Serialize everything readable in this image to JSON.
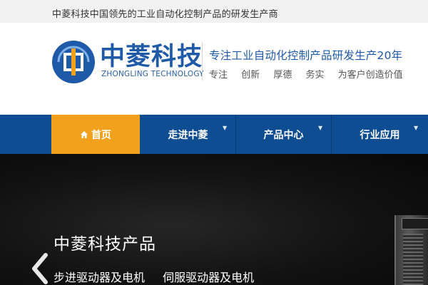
{
  "topbar": {
    "text": "中菱科技中国领先的工业自动化控制产品的研发生产商"
  },
  "header": {
    "logo_name": "中菱科技",
    "logo_en": "ZHONGLING TECHNOLOGY",
    "slogan": "专注工业自动化控制产品研发生产20年",
    "values": [
      "专注",
      "创新",
      "厚德",
      "务实",
      "为客户创造价值"
    ]
  },
  "nav": {
    "items": [
      {
        "label": "首页",
        "icon": "home-icon",
        "active": true
      },
      {
        "label": "走进中菱",
        "dropdown": true
      },
      {
        "label": "产品中心",
        "dropdown": true
      },
      {
        "label": "行业应用",
        "dropdown": true
      }
    ]
  },
  "banner": {
    "title": "中菱科技产品",
    "subs": [
      "步进驱动器及电机",
      "伺服驱动器及电机"
    ]
  },
  "colors": {
    "brand_blue": "#0f4d92",
    "accent_orange": "#f1a11b",
    "logo_blue": "#1e5aa8"
  }
}
